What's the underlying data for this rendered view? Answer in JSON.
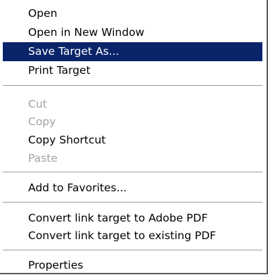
{
  "context_menu": {
    "highlight_color": "#0a246a",
    "disabled_color": "#a3a3a3",
    "items": [
      {
        "label": "Open",
        "enabled": true
      },
      {
        "label": "Open in New Window",
        "enabled": true
      },
      {
        "label": "Save Target As...",
        "enabled": true,
        "highlighted": true
      },
      {
        "label": "Print Target",
        "enabled": true
      },
      {
        "label": "Cut",
        "enabled": false
      },
      {
        "label": "Copy",
        "enabled": false
      },
      {
        "label": "Copy Shortcut",
        "enabled": true
      },
      {
        "label": "Paste",
        "enabled": false
      },
      {
        "label": "Add to Favorites...",
        "enabled": true
      },
      {
        "label": "Convert link target to Adobe PDF",
        "enabled": true
      },
      {
        "label": "Convert link target to existing PDF",
        "enabled": true
      },
      {
        "label": "Properties",
        "enabled": true
      }
    ]
  }
}
